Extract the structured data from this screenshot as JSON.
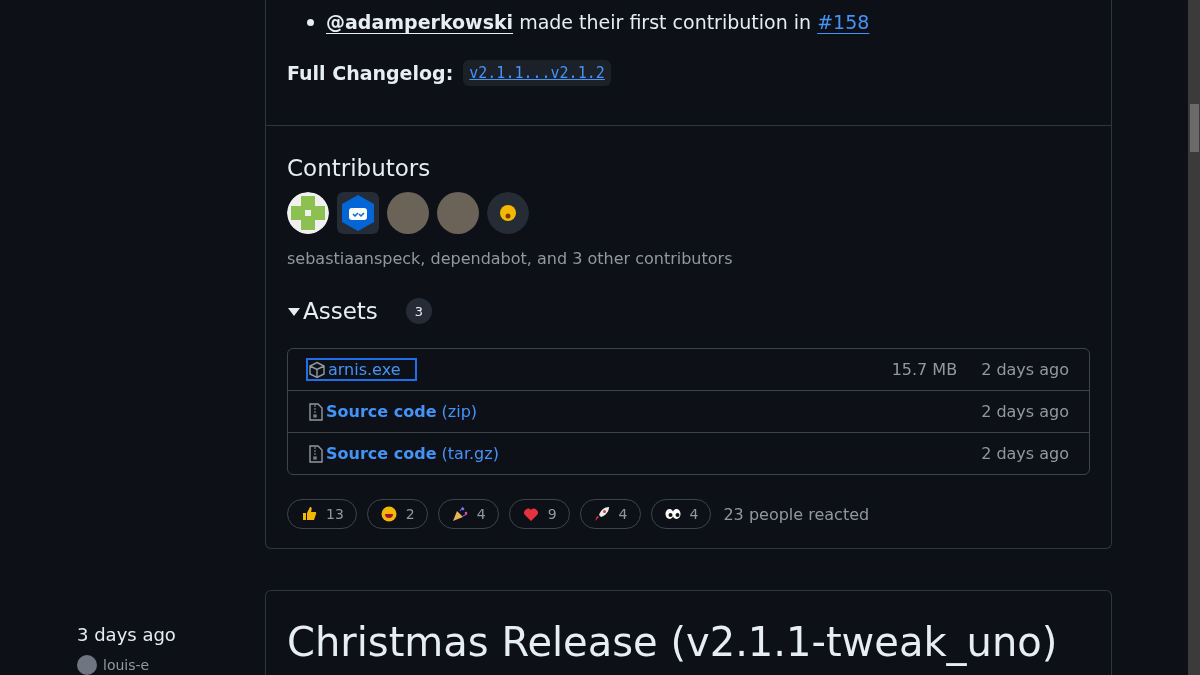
{
  "release_notes": {
    "contribution": {
      "user": "@adamperkowski",
      "text": "made their first contribution in",
      "link": "#158"
    },
    "changelog": {
      "label": "Full Changelog:",
      "link": "v2.1.1...v2.1.2"
    }
  },
  "contributors": {
    "title": "Contributors",
    "avatars": [
      {
        "kind": "identicon"
      },
      {
        "kind": "bot"
      },
      {
        "kind": "photo"
      },
      {
        "kind": "photo"
      },
      {
        "kind": "emoji"
      }
    ],
    "summary": "sebastiaanspeck, dependabot, and 3 other contributors"
  },
  "assets": {
    "title": "Assets",
    "expanded": true,
    "count": "3",
    "items": [
      {
        "kind": "package",
        "name": "arnis.exe",
        "focused": true,
        "size": "15.7 MB",
        "date": "2 days ago"
      },
      {
        "kind": "archive",
        "name": "**Source code** (zip)",
        "focused": false,
        "date": "2 days ago"
      },
      {
        "kind": "archive",
        "name": "**Source code** (tar.gz)",
        "focused": false,
        "date": "2 days ago"
      }
    ]
  },
  "reactions": {
    "items": [
      {
        "kind": "thumbs-up",
        "count": "13"
      },
      {
        "kind": "smile",
        "count": "2"
      },
      {
        "kind": "party",
        "count": "4"
      },
      {
        "kind": "heart",
        "count": "9"
      },
      {
        "kind": "rocket",
        "count": "4"
      },
      {
        "kind": "eyes",
        "count": "4"
      }
    ],
    "summary": "23 people reacted"
  },
  "next_release": {
    "date": "3 days ago",
    "author": "louis-e",
    "title": "Christmas Release (v2.1.1-tweak_uno)"
  }
}
